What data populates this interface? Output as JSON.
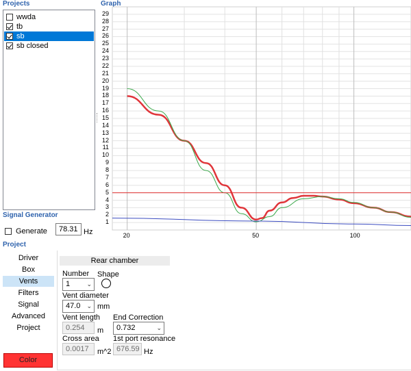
{
  "sections": {
    "projects": "Projects",
    "graph": "Graph",
    "signal_generator": "Signal Generator",
    "project": "Project"
  },
  "projects": [
    {
      "label": "wwda",
      "checked": false,
      "selected": false
    },
    {
      "label": "tb",
      "checked": true,
      "selected": false
    },
    {
      "label": "sb",
      "checked": true,
      "selected": true
    },
    {
      "label": "sb closed",
      "checked": true,
      "selected": false
    }
  ],
  "signal": {
    "generate_label": "Generate",
    "generate_checked": false,
    "frequency": "78.31",
    "unit": "Hz"
  },
  "nav": [
    "Driver",
    "Box",
    "Vents",
    "Filters",
    "Signal",
    "Advanced",
    "Project"
  ],
  "nav_selected": "Vents",
  "color_button": "Color",
  "rear_chamber": {
    "header": "Rear chamber",
    "number_label": "Number",
    "number_value": "1",
    "shape_label": "Shape",
    "vent_diameter_label": "Vent diameter",
    "vent_diameter_value": "47.0",
    "vent_diameter_unit": "mm",
    "vent_length_label": "Vent length",
    "vent_length_value": "0.254",
    "vent_length_unit": "m",
    "end_correction_label": "End Correction",
    "end_correction_value": "0.732",
    "cross_area_label": "Cross area",
    "cross_area_value": "0.0017",
    "cross_area_unit": "m^2",
    "port_resonance_label": "1st port resonance",
    "port_resonance_value": "676.59",
    "port_resonance_unit": "Hz"
  },
  "colors": {
    "accent": "#0078d7",
    "section_title": "#2f63ad",
    "curve_sb": "#e0353a",
    "curve_green": "#3aa84a",
    "curve_blue": "#3b4cc0",
    "ref_line": "#e03030",
    "color_button": "#ff3333"
  },
  "chart_data": {
    "type": "line",
    "x_scale": "log",
    "xlim": [
      18,
      150
    ],
    "ylim": [
      0,
      30
    ],
    "x_ticks": [
      "20",
      "50",
      "100"
    ],
    "y_ticks": [
      "1",
      "2",
      "3",
      "4",
      "5",
      "6",
      "7",
      "8",
      "9",
      "10",
      "11",
      "12",
      "13",
      "14",
      "15",
      "16",
      "17",
      "18",
      "19",
      "20",
      "21",
      "22",
      "23",
      "24",
      "25",
      "26",
      "27",
      "28",
      "29"
    ],
    "grid": true,
    "series": [
      {
        "color": "#e0353a",
        "width": 2.5,
        "x": [
          20,
          25,
          30,
          35,
          40,
          45,
          50,
          52,
          55,
          60,
          65,
          70,
          75,
          80,
          90,
          100,
          115,
          130,
          150
        ],
        "y": [
          18,
          15.5,
          12,
          9,
          6,
          3,
          1.4,
          1.6,
          2.6,
          3.7,
          4.3,
          4.6,
          4.6,
          4.5,
          4.1,
          3.6,
          3,
          2.4,
          1.8
        ]
      },
      {
        "color": "#3aa84a",
        "width": 1,
        "x": [
          20,
          25,
          30,
          35,
          40,
          45,
          50,
          55,
          60,
          70,
          80,
          90,
          100,
          115,
          130,
          150
        ],
        "y": [
          19,
          16,
          12,
          8,
          5,
          2.2,
          1.1,
          1.8,
          3,
          4.2,
          4.5,
          4.2,
          3.7,
          3,
          2.4,
          1.7
        ]
      },
      {
        "color": "#3b4cc0",
        "width": 1,
        "x": [
          18,
          50,
          100,
          150
        ],
        "y": [
          1.6,
          1.2,
          0.8,
          0.6
        ]
      },
      {
        "color": "#e03030",
        "width": 1,
        "x": [
          18,
          150
        ],
        "y": [
          5,
          5
        ]
      }
    ]
  }
}
